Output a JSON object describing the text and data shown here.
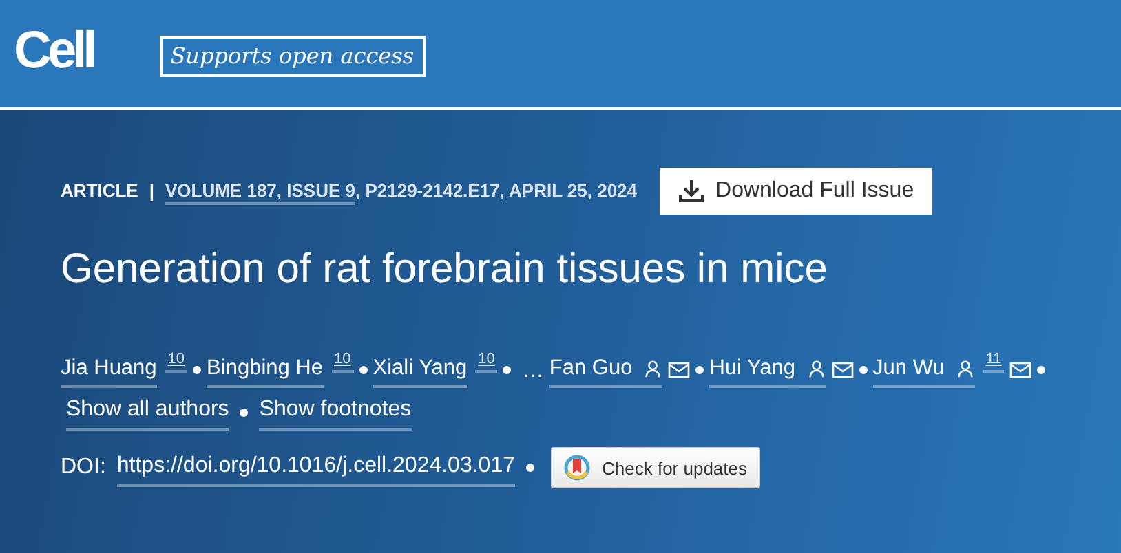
{
  "header": {
    "logo": "Cell",
    "tagline": "Supports open access"
  },
  "meta": {
    "type": "ARTICLE",
    "separator": "|",
    "volume_link": "VOLUME 187, ISSUE 9",
    "details": ", P2129-2142.E17, APRIL 25, 2024",
    "download_button": "Download Full Issue"
  },
  "title": "Generation of rat forebrain tissues in mice",
  "authors": [
    {
      "name": "Jia Huang",
      "footnote": "10",
      "profile": false,
      "email": false
    },
    {
      "name": "Bingbing He",
      "footnote": "10",
      "profile": false,
      "email": false
    },
    {
      "name": "Xiali Yang",
      "footnote": "10",
      "profile": false,
      "email": false
    },
    {
      "name": "…",
      "kind": "ellipsis"
    },
    {
      "name": "Fan Guo",
      "profile": true,
      "email": true
    },
    {
      "name": "Hui Yang",
      "profile": true,
      "email": true
    },
    {
      "name": "Jun Wu",
      "footnote": "11",
      "profile": true,
      "email": true
    }
  ],
  "author_links": [
    "Show all authors",
    "Show footnotes"
  ],
  "doi": {
    "label": "DOI:",
    "link": "https://doi.org/10.1016/j.cell.2024.03.017",
    "updates_button": "Check for updates"
  }
}
